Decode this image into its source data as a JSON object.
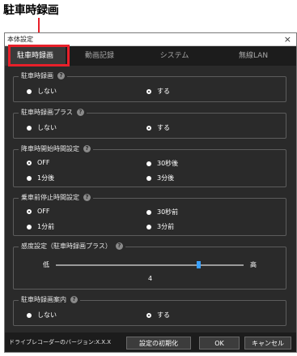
{
  "callout": {
    "label": "駐車時録画"
  },
  "window": {
    "title": "本体設定",
    "close_glyph": "×"
  },
  "tabs": [
    {
      "label": "駐車時録画",
      "active": true
    },
    {
      "label": "動画記録",
      "active": false
    },
    {
      "label": "システム",
      "active": false
    },
    {
      "label": "無線LAN",
      "active": false
    }
  ],
  "help_glyph": "?",
  "groups": {
    "parking_rec": {
      "title": "駐車時録画",
      "options": [
        "しない",
        "する"
      ],
      "selected": "する"
    },
    "parking_rec_plus": {
      "title": "駐車時録画プラス",
      "options": [
        "しない",
        "する"
      ],
      "selected": "する"
    },
    "start_delay": {
      "title": "降車時開始時間設定",
      "options": [
        "OFF",
        "30秒後",
        "1分後",
        "3分後"
      ],
      "selected": "OFF"
    },
    "stop_before": {
      "title": "乗車前停止時間設定",
      "options": [
        "OFF",
        "30秒前",
        "1分前",
        "3分前"
      ],
      "selected": "OFF"
    },
    "sensitivity": {
      "title": "感度設定（駐車時録画プラス）",
      "low": "低",
      "high": "高",
      "value": "4",
      "level_fraction": 0.76
    },
    "guide": {
      "title": "駐車時録画案内",
      "options": [
        "しない",
        "する"
      ],
      "selected": "する"
    }
  },
  "footer": {
    "version": "ドライブレコーダーのバージョン:X.X.X",
    "reset": "設定の初期化",
    "ok": "OK",
    "cancel": "キャンセル"
  },
  "colors": {
    "accent": "#e8202a",
    "slider": "#3aa0ff",
    "panel": "#2a2a2a"
  }
}
